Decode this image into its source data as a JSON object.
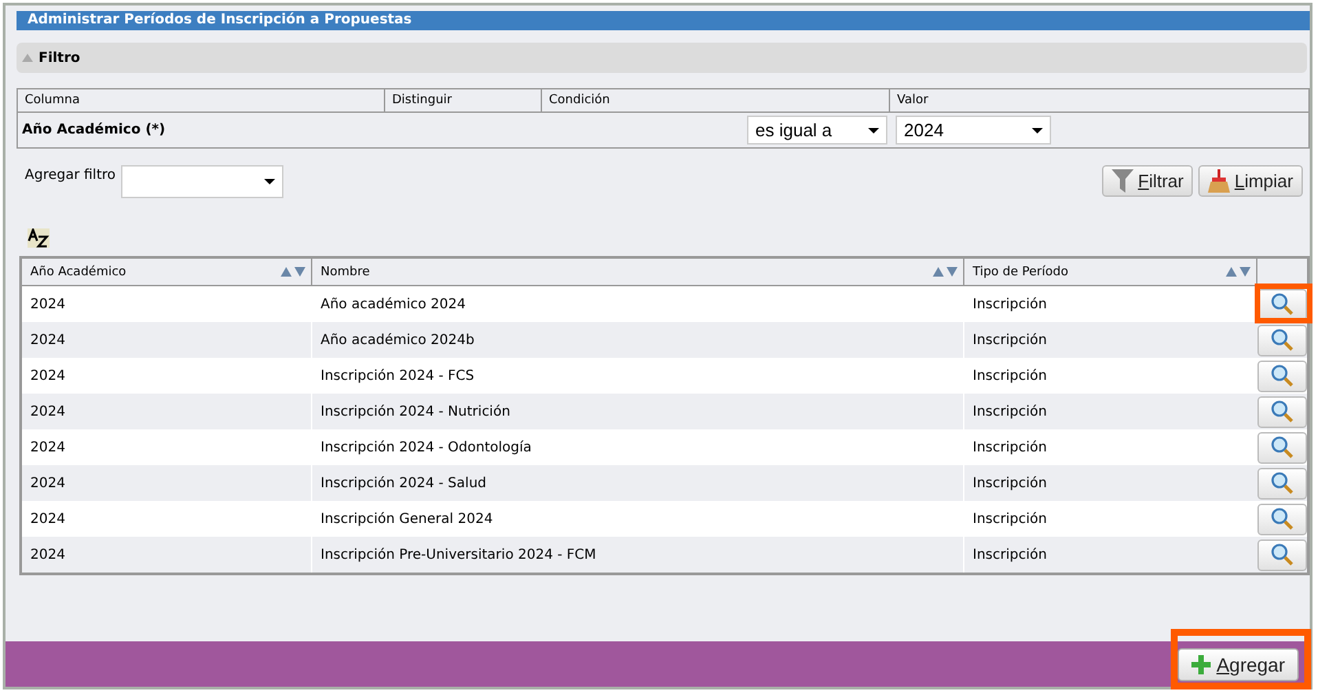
{
  "window": {
    "title": "Administrar Períodos de Inscripción a Propuestas"
  },
  "filter": {
    "title": "Filtro",
    "expanded": true,
    "columns": [
      "Columna",
      "Distinguir",
      "Condición",
      "Valor"
    ],
    "row": {
      "label": "Año Académico (*)",
      "condition": "es igual a",
      "value": "2024"
    },
    "add_filter": {
      "label": "Agregar filtro"
    },
    "buttons": [
      {
        "kind": "filter",
        "label": "Filtrar"
      },
      {
        "kind": "clear",
        "label": "Limpiar"
      }
    ]
  },
  "table": {
    "columns": [
      {
        "label": "Año Académico"
      },
      {
        "label": "Nombre"
      },
      {
        "label": "Tipo de Período"
      }
    ],
    "rows": [
      {
        "year": "2024",
        "name": "Año académico 2024",
        "type": "Inscripción",
        "highlighted": true
      },
      {
        "year": "2024",
        "name": "Año académico 2024b",
        "type": "Inscripción",
        "highlighted": false
      },
      {
        "year": "2024",
        "name": "Inscripción 2024 - FCS",
        "type": "Inscripción",
        "highlighted": false
      },
      {
        "year": "2024",
        "name": "Inscripción 2024 - Nutrición",
        "type": "Inscripción",
        "highlighted": false
      },
      {
        "year": "2024",
        "name": "Inscripción 2024 - Odontología",
        "type": "Inscripción",
        "highlighted": false
      },
      {
        "year": "2024",
        "name": "Inscripción 2024 - Salud",
        "type": "Inscripción",
        "highlighted": false
      },
      {
        "year": "2024",
        "name": "Inscripción General 2024",
        "type": "Inscripción",
        "highlighted": false
      },
      {
        "year": "2024",
        "name": "Inscripción Pre-Universitario 2024 - FCM",
        "type": "Inscripción",
        "highlighted": false
      }
    ]
  },
  "footer": {
    "button": {
      "label": "Agregar",
      "highlighted": true
    }
  }
}
